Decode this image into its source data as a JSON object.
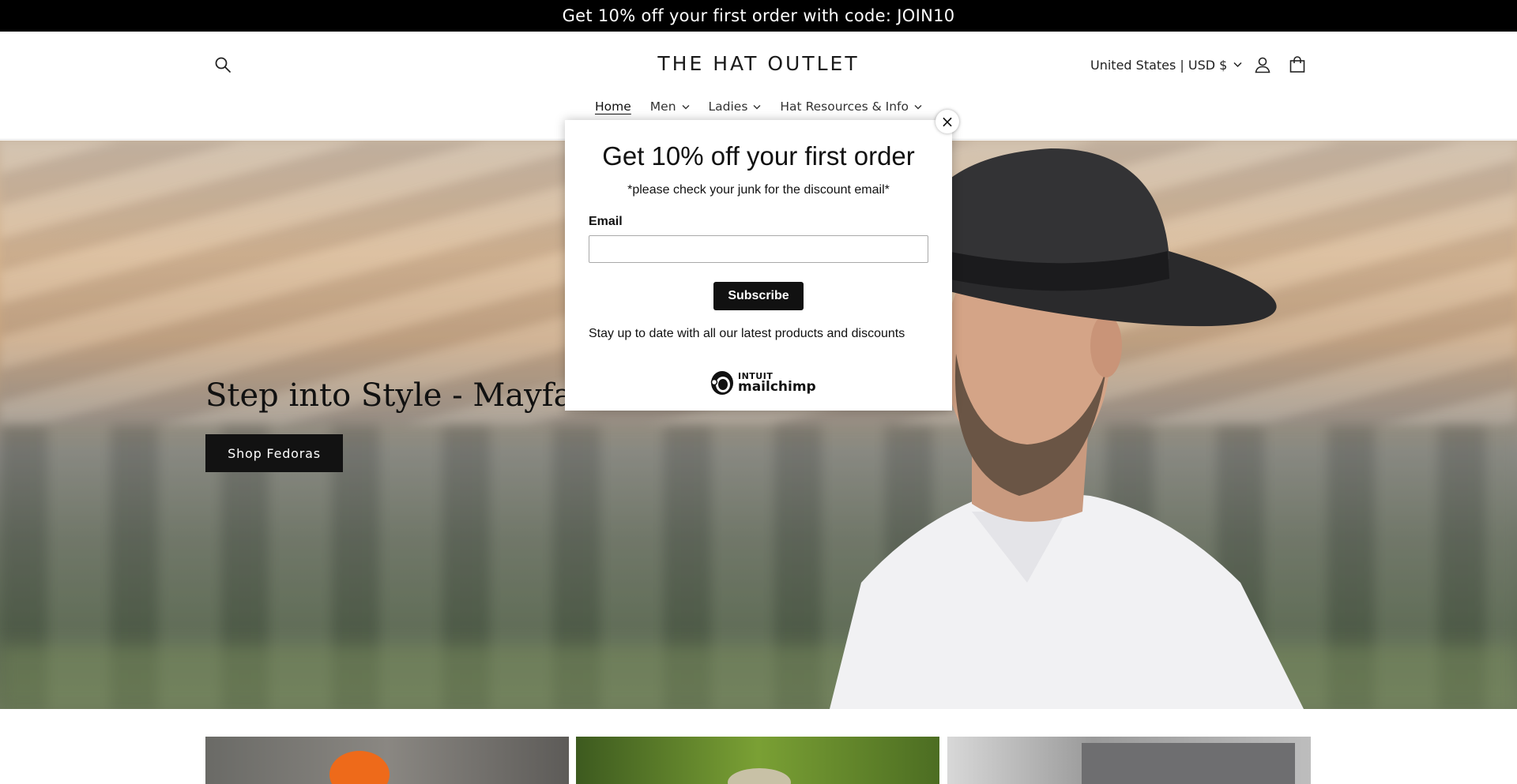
{
  "announcement": {
    "text": "Get 10% off your first order with code: JOIN10"
  },
  "header": {
    "logo": "THE HAT OUTLET",
    "country": "United States | USD $"
  },
  "nav": {
    "items": [
      {
        "label": "Home",
        "active": true,
        "dropdown": false
      },
      {
        "label": "Men",
        "dropdown": true
      },
      {
        "label": "Ladies",
        "dropdown": true
      },
      {
        "label": "Hat Resources & Info",
        "dropdown": true
      }
    ]
  },
  "hero": {
    "title": "Step into Style - Mayfair Fe",
    "button": "Shop Fedoras"
  },
  "popup": {
    "title": "Get 10% off your first order",
    "subtitle": "*please check your junk for the discount email*",
    "email_label": "Email",
    "email_value": "",
    "subscribe": "Subscribe",
    "note": "Stay up to date with all our latest products and discounts",
    "brand_top": "INTUIT",
    "brand_bottom": "mailchimp",
    "close": "×"
  },
  "colors": {
    "accent": "#121212",
    "announcement_bg": "#000000"
  },
  "icons": [
    "search-icon",
    "account-icon",
    "cart-icon",
    "chevron-down-icon",
    "close-icon",
    "mailchimp-logo-icon"
  ]
}
